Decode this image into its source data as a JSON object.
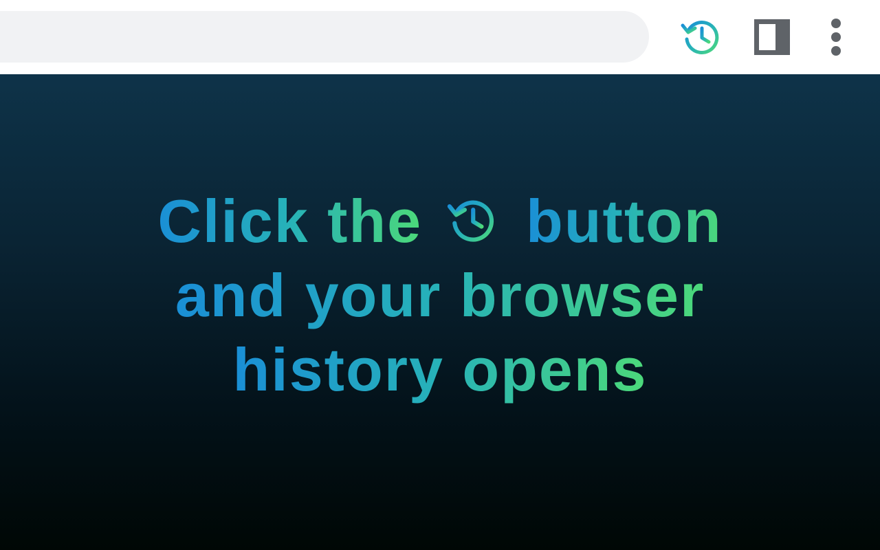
{
  "toolbar": {
    "omnibox_value": "",
    "buttons": [
      {
        "name": "history",
        "icon": "history-icon"
      },
      {
        "name": "side-panel",
        "icon": "side-panel-icon"
      },
      {
        "name": "menu",
        "icon": "more-vert-icon"
      }
    ]
  },
  "hero": {
    "line1_before": "Click the",
    "line1_icon": "history-icon",
    "line1_after": "button",
    "line2": "and your browser",
    "line3": "history opens"
  },
  "colors": {
    "gradient_start": "#1a8fd6",
    "gradient_mid": "#27b2b8",
    "gradient_end": "#4cd97a",
    "background_top": "#0e3349",
    "background_bottom": "#000705",
    "toolbar_icon_gray": "#5f6368",
    "omnibox_fill": "#f1f2f4"
  }
}
